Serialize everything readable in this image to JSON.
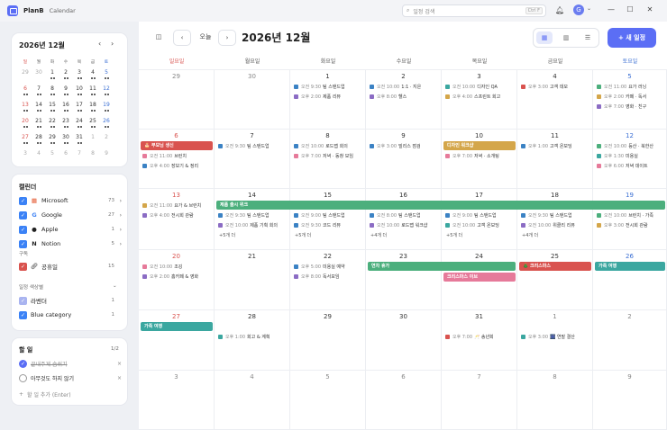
{
  "app": {
    "name": "PlanB",
    "tab": "Calendar"
  },
  "search": {
    "placeholder": "일정 검색",
    "shortcut": "Ctrl F"
  },
  "avatar": {
    "initial": "G"
  },
  "window": {
    "min": "—",
    "max": "☐",
    "close": "✕"
  },
  "mini": {
    "title": "2026년 12월",
    "prev": "‹",
    "next": "›",
    "weekdays": [
      "일",
      "월",
      "화",
      "수",
      "목",
      "금",
      "토"
    ],
    "weeks": [
      [
        "29",
        "30",
        "1",
        "2",
        "3",
        "4",
        "5"
      ],
      [
        "6",
        "7",
        "8",
        "9",
        "10",
        "11",
        "12"
      ],
      [
        "13",
        "14",
        "15",
        "16",
        "17",
        "18",
        "19"
      ],
      [
        "20",
        "21",
        "22",
        "23",
        "24",
        "25",
        "26"
      ],
      [
        "27",
        "28",
        "29",
        "30",
        "31",
        "1",
        "2"
      ],
      [
        "3",
        "4",
        "5",
        "6",
        "7",
        "8",
        "9"
      ]
    ]
  },
  "calendars": {
    "title": "캘린더",
    "items": [
      {
        "name": "Microsoft",
        "count": "73",
        "color": "#3b82f6",
        "logo": "▦"
      },
      {
        "name": "Google",
        "count": "27",
        "color": "#3b82f6",
        "logo": "G"
      },
      {
        "name": "Apple",
        "count": "1",
        "color": "#3b82f6",
        "logo": ""
      },
      {
        "name": "Notion",
        "count": "5",
        "color": "#3b82f6",
        "logo": "N"
      }
    ],
    "subscribe_title": "구독",
    "shared": {
      "name": "공휴일",
      "count": "15"
    },
    "colors_title": "일정 색상별",
    "color_items": [
      {
        "name": "라벤더",
        "count": "1",
        "color": "#a9b4f0"
      },
      {
        "name": "Blue category",
        "count": "1",
        "color": "#3b82f6"
      }
    ]
  },
  "todo": {
    "title": "할 일",
    "count": "1/2",
    "items": [
      {
        "text": "끝내주게 숨쉬기",
        "done": true
      },
      {
        "text": "아무것도 하지 않기",
        "done": false
      }
    ],
    "add": "할 일 추가 (Enter)"
  },
  "toolbar": {
    "today": "오늘",
    "prev": "‹",
    "next": "›",
    "title": "2026년 12월",
    "new_event": "새 일정"
  },
  "weekdays": [
    "일요일",
    "월요일",
    "화요일",
    "수요일",
    "목요일",
    "금요일",
    "토요일"
  ],
  "weeks": [
    [
      "29",
      "30",
      "1",
      "2",
      "3",
      "4",
      "5"
    ],
    [
      "6",
      "7",
      "8",
      "9",
      "10",
      "11",
      "12"
    ],
    [
      "13",
      "14",
      "15",
      "16",
      "17",
      "18",
      "19"
    ],
    [
      "20",
      "21",
      "22",
      "23",
      "24",
      "25",
      "26"
    ],
    [
      "27",
      "28",
      "29",
      "30",
      "31",
      "1",
      "2"
    ],
    [
      "3",
      "4",
      "5",
      "6",
      "7",
      "8",
      "9"
    ]
  ],
  "events": [
    {
      "w": 0,
      "d": 2,
      "r": 0,
      "t": "오전 9:30",
      "n": "팀 스탠드업",
      "c": "#3b82c4"
    },
    {
      "w": 0,
      "d": 2,
      "r": 1,
      "t": "오후 2:00",
      "n": "제품 리뷰",
      "c": "#8b6cc4"
    },
    {
      "w": 0,
      "d": 3,
      "r": 0,
      "t": "오전 10:00",
      "n": "1:1 · 지은",
      "c": "#3b82c4"
    },
    {
      "w": 0,
      "d": 3,
      "r": 1,
      "t": "오후 8:00",
      "n": "헬스",
      "c": "#8b6cc4"
    },
    {
      "w": 0,
      "d": 4,
      "r": 0,
      "t": "오전 10:00",
      "n": "디자인 QA",
      "c": "#3ba7a0"
    },
    {
      "w": 0,
      "d": 4,
      "r": 1,
      "t": "오후 4:00",
      "n": "스프린트 회고",
      "c": "#d4a64a"
    },
    {
      "w": 0,
      "d": 5,
      "r": 0,
      "t": "오후 3:00",
      "n": "고객 데모",
      "c": "#d9534f"
    },
    {
      "w": 0,
      "d": 6,
      "r": 0,
      "t": "오전 11:00",
      "n": "요가 러닝",
      "c": "#4caf7d"
    },
    {
      "w": 0,
      "d": 6,
      "r": 1,
      "t": "오후 2:00",
      "n": "카페 · 독서",
      "c": "#d4a64a"
    },
    {
      "w": 0,
      "d": 6,
      "r": 2,
      "t": "오후 7:00",
      "n": "영화 · 친구",
      "c": "#8b6cc4"
    },
    {
      "w": 1,
      "d": 0,
      "r": 1,
      "t": "오전 11:00",
      "n": "브런치",
      "c": "#e67a9a"
    },
    {
      "w": 1,
      "d": 0,
      "r": 2,
      "t": "오후 4:00",
      "n": "장보기 & 정리",
      "c": "#3b82c4"
    },
    {
      "w": 1,
      "d": 1,
      "r": 0,
      "t": "오전 9:30",
      "n": "팀 스탠드업",
      "c": "#3b82c4"
    },
    {
      "w": 1,
      "d": 2,
      "r": 0,
      "t": "오전 10:00",
      "n": "로드맵 회의",
      "c": "#3b82c4"
    },
    {
      "w": 1,
      "d": 2,
      "r": 1,
      "t": "오후 7:00",
      "n": "저녁 · 동창 모임",
      "c": "#e67a9a"
    },
    {
      "w": 1,
      "d": 3,
      "r": 0,
      "t": "오후 3:00",
      "n": "빌리스 점검",
      "c": "#3b82c4"
    },
    {
      "w": 1,
      "d": 4,
      "r": 1,
      "t": "오후 7:00",
      "n": "저녁 · 소개팅",
      "c": "#e67a9a"
    },
    {
      "w": 1,
      "d": 5,
      "r": 0,
      "t": "오후 1:00",
      "n": "고객 온보딩",
      "c": "#3b82c4"
    },
    {
      "w": 1,
      "d": 6,
      "r": 0,
      "t": "오전 10:00",
      "n": "등산 · 북한산",
      "c": "#4caf7d"
    },
    {
      "w": 1,
      "d": 6,
      "r": 1,
      "t": "오후 1:30",
      "n": "미용실",
      "c": "#3ba7a0"
    },
    {
      "w": 1,
      "d": 6,
      "r": 2,
      "t": "오후 6:00",
      "n": "저녁 데이트",
      "c": "#e67a9a"
    },
    {
      "w": 2,
      "d": 0,
      "r": 0,
      "t": "오전 11:00",
      "n": "요가 & 브런치",
      "c": "#d4a64a"
    },
    {
      "w": 2,
      "d": 0,
      "r": 1,
      "t": "오후 4:00",
      "n": "전시회 관람",
      "c": "#8b6cc4"
    },
    {
      "w": 2,
      "d": 1,
      "r": 1,
      "t": "오전 9:30",
      "n": "팀 스탠드업",
      "c": "#3b82c4"
    },
    {
      "w": 2,
      "d": 1,
      "r": 2,
      "t": "오전 10:00",
      "n": "제품 기획 회의",
      "c": "#8b6cc4"
    },
    {
      "w": 2,
      "d": 2,
      "r": 1,
      "t": "오전 9:00",
      "n": "팀 스탠드업",
      "c": "#3b82c4"
    },
    {
      "w": 2,
      "d": 2,
      "r": 2,
      "t": "오전 9:30",
      "n": "코드 리뷰",
      "c": "#3b82c4"
    },
    {
      "w": 2,
      "d": 3,
      "r": 1,
      "t": "오전 8:00",
      "n": "팀 스탠드업",
      "c": "#3b82c4"
    },
    {
      "w": 2,
      "d": 3,
      "r": 2,
      "t": "오전 10:00",
      "n": "로드맵 워크샵",
      "c": "#8b6cc4"
    },
    {
      "w": 2,
      "d": 4,
      "r": 1,
      "t": "오전 9:00",
      "n": "팀 스탠드업",
      "c": "#3b82c4"
    },
    {
      "w": 2,
      "d": 4,
      "r": 2,
      "t": "오전 10:00",
      "n": "고객 온보딩",
      "c": "#3ba7a0"
    },
    {
      "w": 2,
      "d": 5,
      "r": 1,
      "t": "오전 9:30",
      "n": "팀 스탠드업",
      "c": "#3b82c4"
    },
    {
      "w": 2,
      "d": 5,
      "r": 2,
      "t": "오전 10:00",
      "n": "위클리 리뷰",
      "c": "#8b6cc4"
    },
    {
      "w": 2,
      "d": 6,
      "r": 1,
      "t": "오전 10:00",
      "n": "브런치 · 가족",
      "c": "#4caf7d"
    },
    {
      "w": 2,
      "d": 6,
      "r": 2,
      "t": "오후 3:00",
      "n": "전시회 관람",
      "c": "#d4a64a"
    },
    {
      "w": 3,
      "d": 0,
      "r": 0,
      "t": "오전 10:00",
      "n": "조깅",
      "c": "#e67a9a"
    },
    {
      "w": 3,
      "d": 0,
      "r": 1,
      "t": "오후 2:00",
      "n": "홈카페 & 영화",
      "c": "#8b6cc4"
    },
    {
      "w": 3,
      "d": 2,
      "r": 0,
      "t": "오후 5:00",
      "n": "미용실 예약",
      "c": "#3b82c4"
    },
    {
      "w": 3,
      "d": 2,
      "r": 1,
      "t": "오후 8:00",
      "n": "독서모임",
      "c": "#8b6cc4"
    },
    {
      "w": 4,
      "d": 1,
      "r": 1,
      "t": "오후 1:00",
      "n": "회고 & 계획",
      "c": "#3ba7a0"
    },
    {
      "w": 4,
      "d": 4,
      "r": 1,
      "t": "오후 7:00",
      "n": "🥂 송년회",
      "c": "#d9534f"
    },
    {
      "w": 4,
      "d": 5,
      "r": 1,
      "t": "오후 3:00",
      "n": "🎆 연말 결산",
      "c": "#3ba7a0"
    }
  ],
  "bars": [
    {
      "w": 1,
      "d0": 0,
      "d1": 0,
      "n": "🎂 부모님 생신",
      "c": "#d9534f"
    },
    {
      "w": 1,
      "d0": 4,
      "d1": 4,
      "n": "디자인 워크샵",
      "c": "#d4a64a"
    },
    {
      "w": 2,
      "d0": 1,
      "d1": 6,
      "n": "제품 출시 위크",
      "c": "#4caf7d"
    },
    {
      "w": 3,
      "d0": 3,
      "d1": 4,
      "n": "연차 휴가",
      "c": "#4caf7d"
    },
    {
      "w": 3,
      "d0": 5,
      "d1": 5,
      "n": "🎄 크리스마스",
      "c": "#d9534f"
    },
    {
      "w": 3,
      "d0": 6,
      "d1": 6,
      "n": "가족 여행",
      "c": "#3ba7a0"
    },
    {
      "w": 4,
      "d0": 0,
      "d1": 0,
      "n": "가족 여행",
      "c": "#3ba7a0"
    }
  ],
  "bars_row2": [
    {
      "w": 3,
      "d0": 4,
      "d1": 4,
      "n": "크리스마스 이브",
      "c": "#e67a9a"
    }
  ],
  "more": [
    {
      "w": 2,
      "d": 1,
      "n": "+5개 더"
    },
    {
      "w": 2,
      "d": 2,
      "n": "+5개 더"
    },
    {
      "w": 2,
      "d": 3,
      "n": "+4개 더"
    },
    {
      "w": 2,
      "d": 4,
      "n": "+5개 더"
    },
    {
      "w": 2,
      "d": 5,
      "n": "+4개 더"
    }
  ]
}
